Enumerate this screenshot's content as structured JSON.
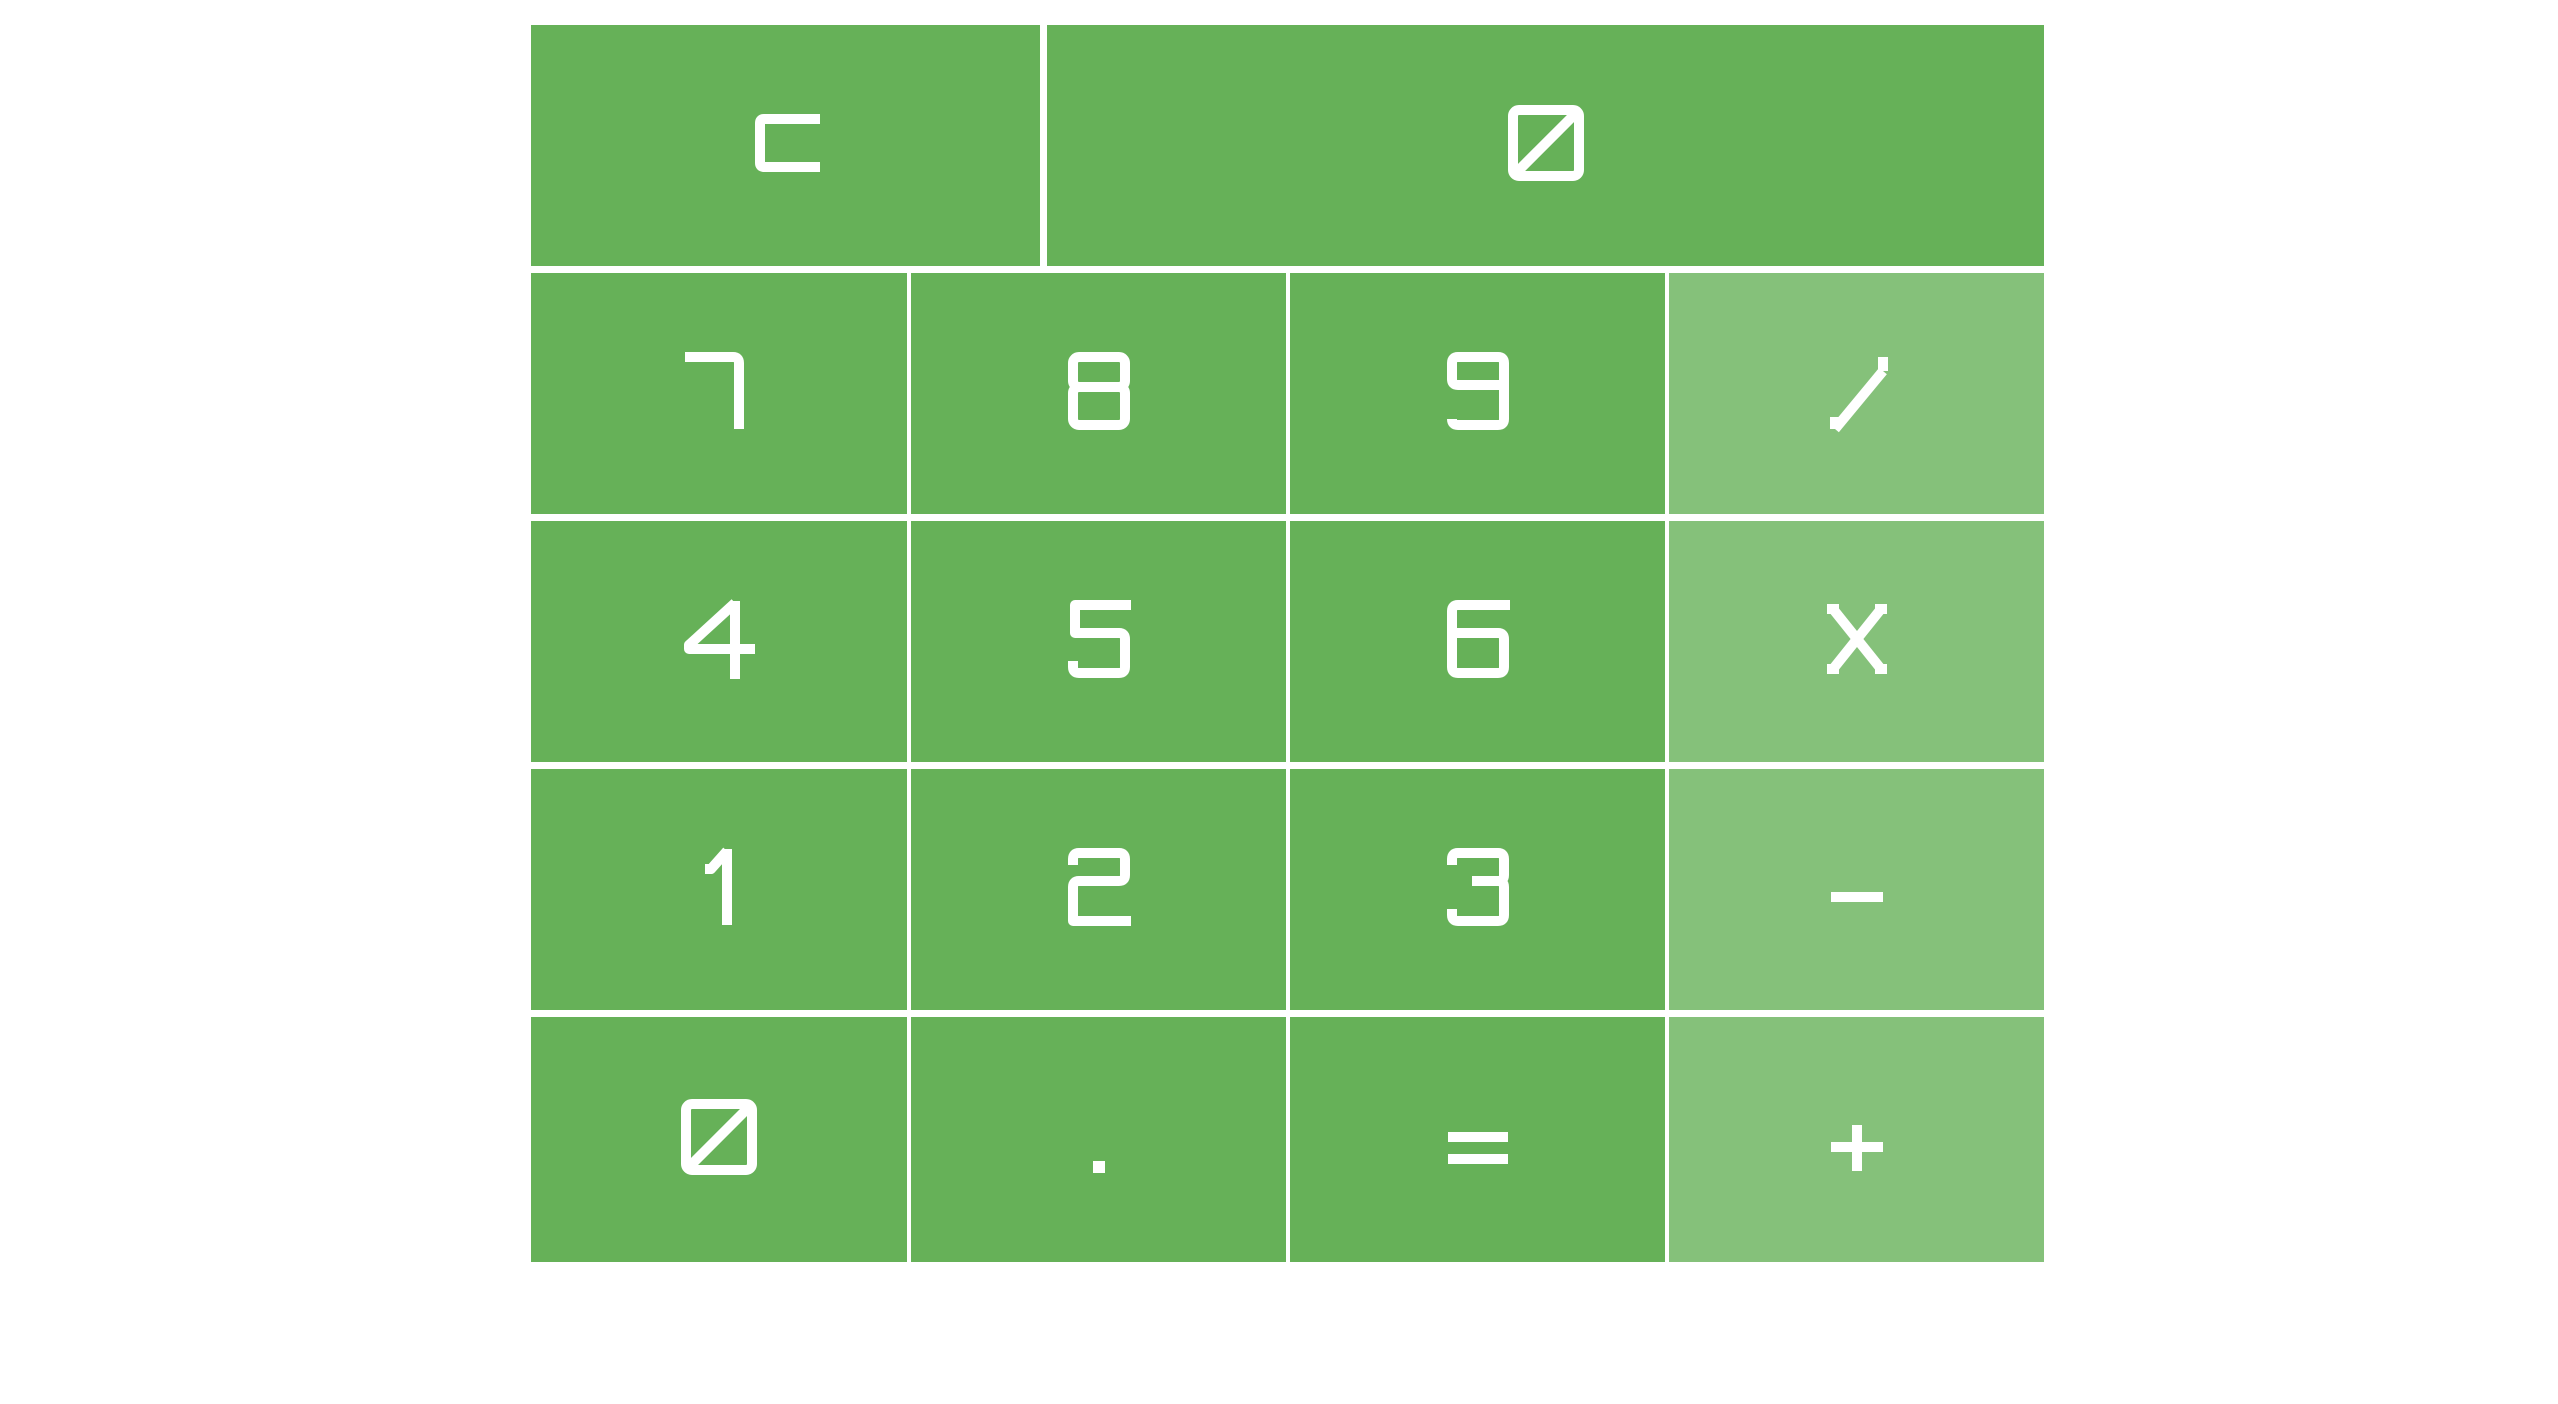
{
  "calculator": {
    "clear_key": {
      "label": "c",
      "glyph": "c-icon"
    },
    "display": {
      "value": "0",
      "glyph": "digit-0-icon"
    },
    "keys": [
      {
        "label": "7",
        "glyph": "digit-7-icon",
        "kind": "digit"
      },
      {
        "label": "8",
        "glyph": "digit-8-icon",
        "kind": "digit"
      },
      {
        "label": "9",
        "glyph": "digit-9-icon",
        "kind": "digit"
      },
      {
        "label": "/",
        "glyph": "divide-icon",
        "kind": "operator"
      },
      {
        "label": "4",
        "glyph": "digit-4-icon",
        "kind": "digit"
      },
      {
        "label": "5",
        "glyph": "digit-5-icon",
        "kind": "digit"
      },
      {
        "label": "6",
        "glyph": "digit-6-icon",
        "kind": "digit"
      },
      {
        "label": "x",
        "glyph": "multiply-icon",
        "kind": "operator"
      },
      {
        "label": "1",
        "glyph": "digit-1-icon",
        "kind": "digit"
      },
      {
        "label": "2",
        "glyph": "digit-2-icon",
        "kind": "digit"
      },
      {
        "label": "3",
        "glyph": "digit-3-icon",
        "kind": "digit"
      },
      {
        "label": "-",
        "glyph": "minus-icon",
        "kind": "operator"
      },
      {
        "label": "0",
        "glyph": "digit-0-icon",
        "kind": "digit"
      },
      {
        "label": ".",
        "glyph": "decimal-point-icon",
        "kind": "digit"
      },
      {
        "label": "=",
        "glyph": "equals-icon",
        "kind": "digit"
      },
      {
        "label": "+",
        "glyph": "plus-icon",
        "kind": "operator"
      }
    ]
  },
  "colors": {
    "key": "#66b158",
    "operator_key": "#85c17a",
    "glyph": "#ffffff",
    "background": "#ffffff"
  }
}
